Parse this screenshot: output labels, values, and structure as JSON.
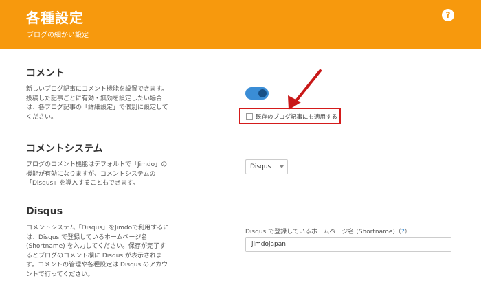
{
  "header": {
    "title": "各種設定",
    "subtitle": "ブログの細かい設定",
    "help_glyph": "?"
  },
  "comment": {
    "title": "コメント",
    "description": "新しいブログ記事にコメント機能を設置できます。投稿した記事ごとに有効・無効を設定したい場合は、各ブログ記事の「詳細設定」で個別に設定してください。",
    "toggle_on": true,
    "apply_existing_label": "既存のブログ記事にも適用する"
  },
  "comment_system": {
    "title": "コメントシステム",
    "description": "ブログのコメント機能はデフォルトで「Jimdo」の機能が有効になりますが、コメントシステムの「Disqus」を導入することもできます。",
    "selected": "Disqus"
  },
  "disqus": {
    "title": "Disqus",
    "description": "コメントシステム「Disqus」をJimdoで利用するには、Disqus で登録しているホームページ名 (Shortname) を入力してください。保存が完了するとブログのコメント欄に Disqus が表示されます。コメントの管理や各種設定は Disqus のアカウントで行ってください。",
    "field_label": "Disqus で登録しているホームページ名 (Shortname)（",
    "field_help": "?",
    "field_label_end": "）",
    "shortname_value": "jimdojapan"
  },
  "colors": {
    "accent": "#f7990d",
    "toggle": "#3a8dd6",
    "highlight": "#d41b1b"
  }
}
